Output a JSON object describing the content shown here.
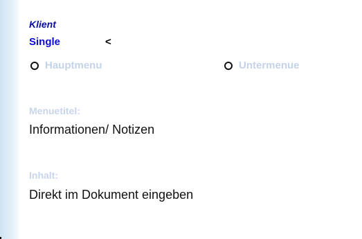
{
  "panel": {
    "client_title": "Klient",
    "client_name": "Single",
    "back_label": "<"
  },
  "radio_options": {
    "main_menu": "Hauptmenu",
    "sub_menu": "Untermenue"
  },
  "menu_title": {
    "label": "Menuetitel:",
    "value": "Informationen/ Notizen"
  },
  "content": {
    "label": "Inhalt:",
    "value": "Direkt im Dokument eingeben"
  },
  "colors": {
    "title": "#0c0ca8",
    "client_name": "#0c0cd0",
    "disabled_label": "#c4d3ea",
    "text": "#111111"
  }
}
